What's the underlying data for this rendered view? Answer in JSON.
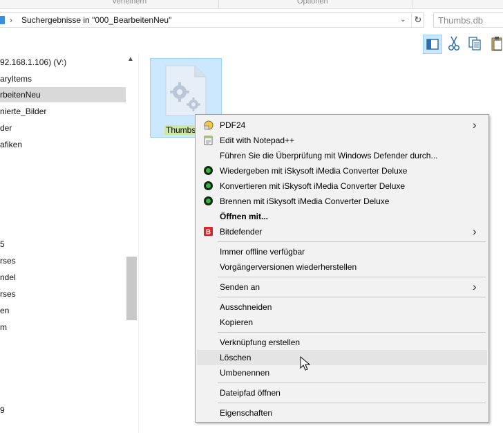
{
  "ribbon": {
    "sections": [
      "Verfeinern",
      "Optionen"
    ]
  },
  "addressbar": {
    "path": "Suchergebnisse in \"000_BearbeitenNeu\"",
    "search_value": "Thumbs.db"
  },
  "nav_pane": {
    "items": [
      {
        "label": "92.168.1.106) (V:)",
        "selected": false
      },
      {
        "label": "aryItems",
        "selected": false
      },
      {
        "label": "rbeitenNeu",
        "selected": true
      },
      {
        "label": "nierte_Bilder",
        "selected": false
      },
      {
        "label": "der",
        "selected": false
      },
      {
        "label": "afiken",
        "selected": false
      },
      {
        "label": "5",
        "selected": false
      },
      {
        "label": "rses",
        "selected": false
      },
      {
        "label": "ndel",
        "selected": false
      },
      {
        "label": "rses",
        "selected": false
      },
      {
        "label": "en",
        "selected": false
      },
      {
        "label": "m",
        "selected": false
      },
      {
        "label": "9",
        "selected": false
      }
    ]
  },
  "file": {
    "name": "Thumbs"
  },
  "context_menu": {
    "items": [
      {
        "label": "PDF24",
        "icon": "pdf24-icon",
        "submenu": true
      },
      {
        "label": "Edit with Notepad++",
        "icon": "notepadpp-icon"
      },
      {
        "label": "Führen Sie die Überprüfung mit Windows Defender durch..."
      },
      {
        "label": "Wiedergeben mit iSkysoft iMedia Converter Deluxe",
        "icon": "iskysoft-icon"
      },
      {
        "label": "Konvertieren mit iSkysoft iMedia Converter Deluxe",
        "icon": "iskysoft-icon"
      },
      {
        "label": "Brennen mit iSkysoft iMedia Converter Deluxe",
        "icon": "iskysoft-icon"
      },
      {
        "label": "Öffnen mit..."
      },
      {
        "label": "Bitdefender",
        "icon": "bitdefender-icon",
        "submenu": true
      },
      {
        "label": "Immer offline verfügbar"
      },
      {
        "label": "Vorgängerversionen wiederherstellen"
      },
      {
        "label": "Senden an",
        "submenu": true
      },
      {
        "label": "Ausschneiden"
      },
      {
        "label": "Kopieren"
      },
      {
        "label": "Verknüpfung erstellen"
      },
      {
        "label": "Löschen"
      },
      {
        "label": "Umbenennen"
      },
      {
        "label": "Dateipfad öffnen"
      },
      {
        "label": "Eigenschaften"
      }
    ],
    "highlight_color": "#e5ea00",
    "hover_color": "#d9d9d9"
  }
}
